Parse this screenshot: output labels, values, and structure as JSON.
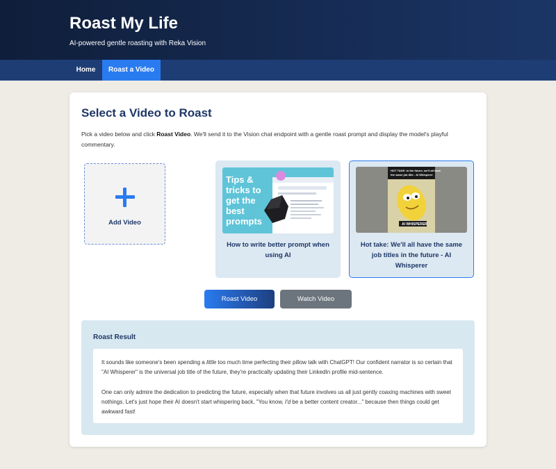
{
  "header": {
    "title": "Roast My Life",
    "subtitle": "AI-powered gentle roasting with Reka Vision"
  },
  "nav": {
    "items": [
      {
        "label": "Home",
        "active": false
      },
      {
        "label": "Roast a Video",
        "active": true
      }
    ]
  },
  "main": {
    "heading": "Select a Video to Roast",
    "intro_pre": "Pick a video below and click ",
    "intro_bold": "Roast Video",
    "intro_post": ". We'll send it to the Vision chat endpoint with a gentle roast prompt and display the model's playful commentary.",
    "add_video_label": "Add Video",
    "videos": [
      {
        "title": "How to write better prompt when using AI",
        "thumb_text": "Tips & tricks to get the best prompts",
        "selected": false
      },
      {
        "title": "Hot take: We'll all have the same job titles in the future - AI Whisperer",
        "thumb_caption": "HOT TAKE: In the future, we'll all have the same job title - AI Whisperer",
        "thumb_badge": "AI WHISPERER",
        "selected": true
      }
    ],
    "buttons": {
      "roast": "Roast Video",
      "watch": "Watch Video"
    },
    "result": {
      "title": "Roast Result",
      "p1_pre": "It sounds like someone's been spending a ",
      "p1_em": "little",
      "p1_post": " too much time perfecting their pillow talk with ChatGPT! Our confident narrator is so certain that \"AI Whisperer\" is the universal job title of the future, they're practically updating their LinkedIn profile mid-sentence.",
      "p2_pre": "One can only admire the dedication to predicting the future, especially when that future involves us all just gently coaxing machines with sweet nothings. Let's just hope their AI doesn't start whispering back, \"You know, ",
      "p2_em": "I'd",
      "p2_post": " be a better content creator...\" because then things could get awkward fast!"
    }
  },
  "colors": {
    "accent": "#2a7bf0",
    "header_dark": "#0f1e3a",
    "nav_bg": "#1d3d74",
    "heading": "#1e3766",
    "tile_bg": "#dce8f2",
    "watch_button": "#6c757d"
  }
}
